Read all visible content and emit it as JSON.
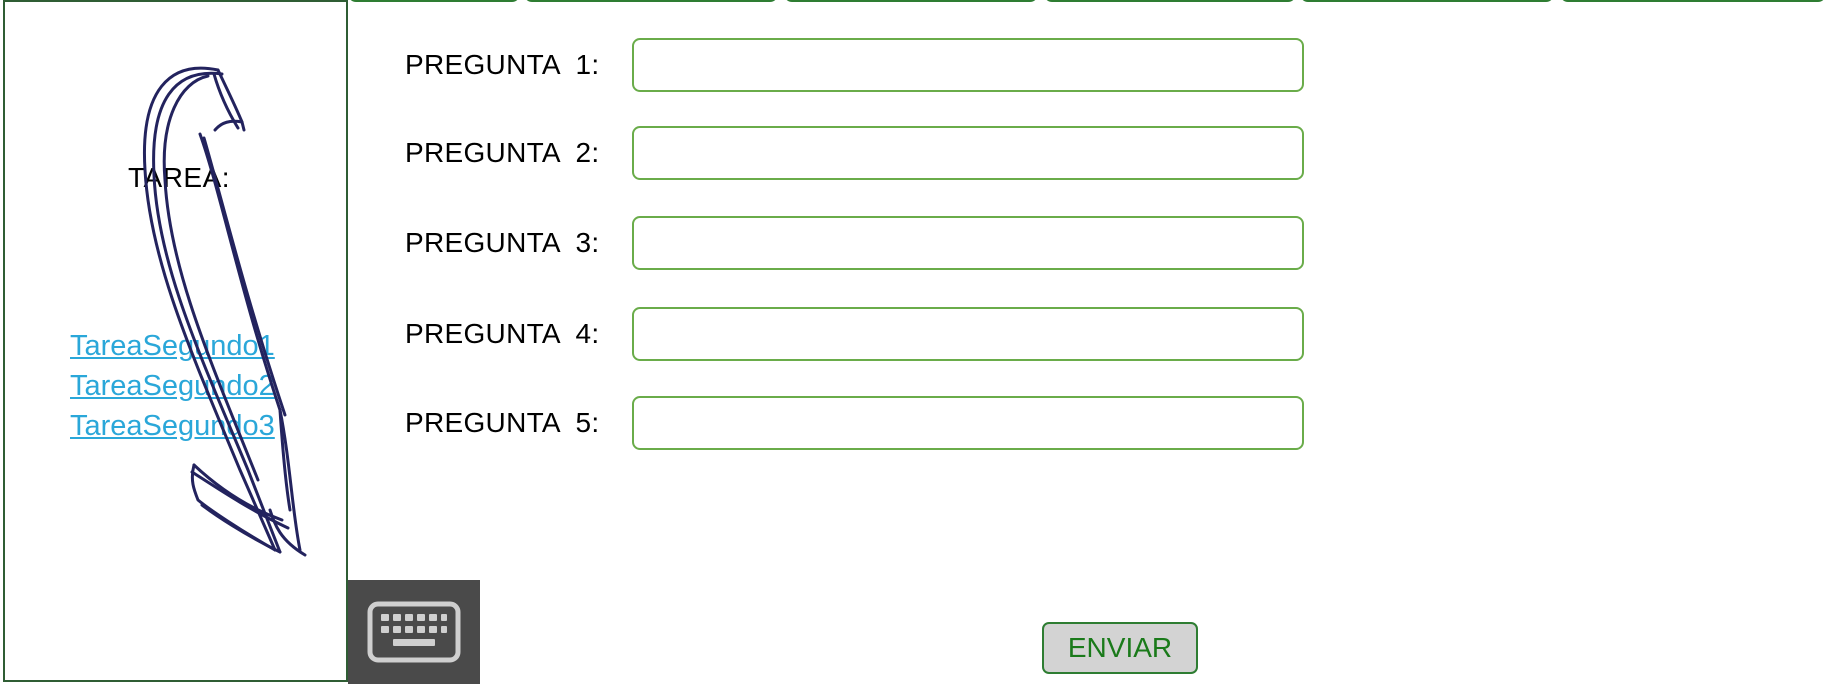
{
  "sidebar": {
    "title": "TAREA:",
    "links": [
      "TareaSegundo1",
      "TareaSegundo2",
      "TareaSegundo3"
    ]
  },
  "questions": [
    {
      "label": "PREGUNTA  1:",
      "value": ""
    },
    {
      "label": "PREGUNTA  2:",
      "value": ""
    },
    {
      "label": "PREGUNTA  3:",
      "value": ""
    },
    {
      "label": "PREGUNTA  4:",
      "value": ""
    },
    {
      "label": "PREGUNTA  5:",
      "value": ""
    }
  ],
  "submit": {
    "label": "ENVIAR"
  },
  "icons": {
    "keyboard": "keyboard-icon",
    "annotation": "hand-drawn-arrow"
  },
  "colors": {
    "border_green": "#2e7d32",
    "input_border": "#6aac4a",
    "link_blue": "#2aa7d9",
    "submit_text": "#1a7a1a",
    "submit_bg": "#d3d3d3",
    "keyboard_bg": "#4a4a4a",
    "arrow_ink": "#23235e"
  }
}
